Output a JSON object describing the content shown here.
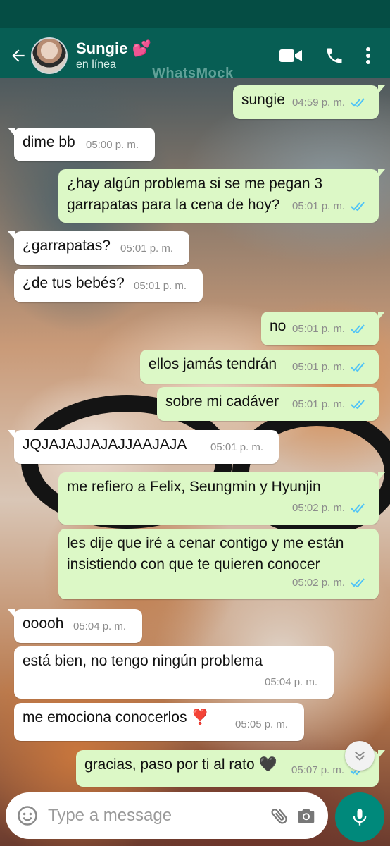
{
  "header": {
    "contact_name": "Sungie 💕",
    "contact_status": "en línea",
    "watermark": "WhatsMock"
  },
  "messages": [
    {
      "dir": "out",
      "text": "sungie",
      "time": "04:59 p. m."
    },
    {
      "dir": "in",
      "text": "dime bb",
      "time": "05:00 p. m."
    },
    {
      "dir": "out",
      "text": "¿hay algún problema si se me pegan 3 garrapatas para la cena de hoy?",
      "time": "05:01 p. m."
    },
    {
      "dir": "in",
      "text": "¿garrapatas?",
      "time": "05:01 p. m."
    },
    {
      "dir": "in",
      "text": "¿de tus bebés?",
      "time": "05:01 p. m."
    },
    {
      "dir": "out",
      "text": "no",
      "time": "05:01 p. m."
    },
    {
      "dir": "out",
      "text": "ellos jamás tendrán",
      "time": "05:01 p. m."
    },
    {
      "dir": "out",
      "text": "sobre mi cadáver",
      "time": "05:01 p. m."
    },
    {
      "dir": "in",
      "text": "JQJAJAJJAJAJJAAJAJA",
      "time": "05:01 p. m."
    },
    {
      "dir": "out",
      "text": "me refiero a Felix, Seungmin y Hyunjin",
      "time": "05:02 p. m."
    },
    {
      "dir": "out",
      "text": "les dije que iré a cenar contigo y me están insistiendo con que te quieren conocer",
      "time": "05:02 p. m."
    },
    {
      "dir": "in",
      "text": "ooooh",
      "time": "05:04 p. m."
    },
    {
      "dir": "in",
      "text": "está bien, no tengo ningún problema",
      "time": "05:04 p. m."
    },
    {
      "dir": "in",
      "text": "me emociona conocerlos ❣️",
      "time": "05:05 p. m."
    },
    {
      "dir": "out",
      "text": "gracias, paso por ti al rato 🖤",
      "time": "05:07 p. m."
    }
  ],
  "composer": {
    "placeholder": "Type a message"
  },
  "icons": {
    "back": "arrow-left-icon",
    "video": "video-camera-icon",
    "call": "phone-icon",
    "menu": "more-vert-icon",
    "emoji": "emoji-icon",
    "attach": "paperclip-icon",
    "camera": "camera-icon",
    "mic": "microphone-icon",
    "read": "double-check-icon",
    "scroll": "chevrons-down-icon"
  },
  "colors": {
    "header": "#075e54",
    "statusbar": "#054d44",
    "outgoing_bubble": "#dcf8c6",
    "incoming_bubble": "#ffffff",
    "read_ticks": "#4fc3f7",
    "mic_button": "#00897b"
  }
}
